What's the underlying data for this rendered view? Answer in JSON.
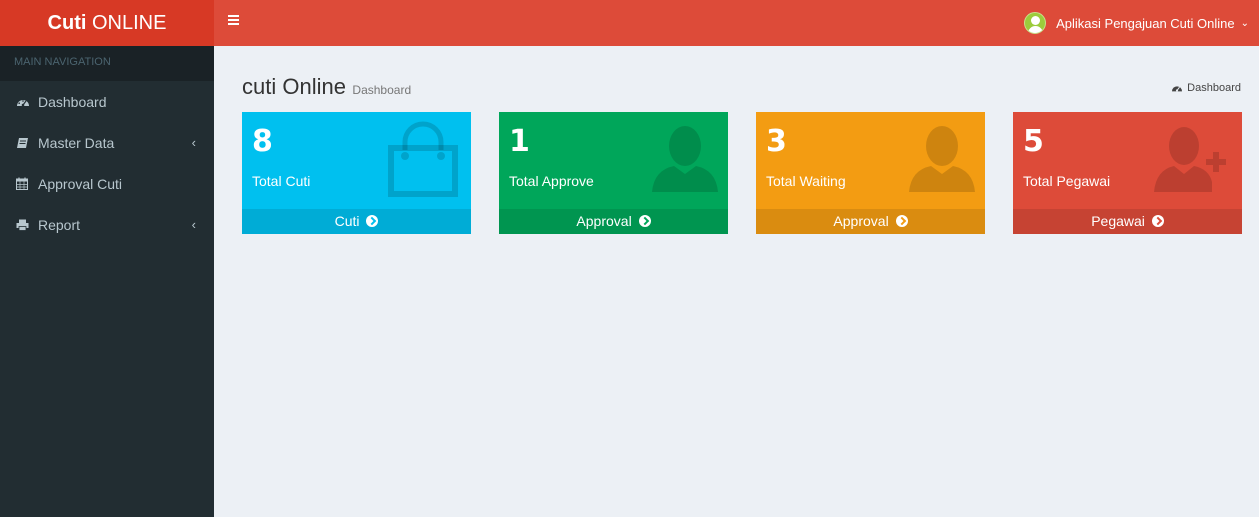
{
  "brand": {
    "bold": "Cuti",
    "rest": " ONLINE"
  },
  "navbar": {
    "user_label": "Aplikasi Pengajuan Cuti Online",
    "caret": "⌄"
  },
  "sidebar": {
    "header": "MAIN NAVIGATION",
    "items": [
      {
        "label": "Dashboard",
        "icon": "dashboard-icon",
        "chevron": ""
      },
      {
        "label": "Master Data",
        "icon": "book-icon",
        "chevron": "‹"
      },
      {
        "label": "Approval Cuti",
        "icon": "calendar-icon",
        "chevron": ""
      },
      {
        "label": "Report",
        "icon": "print-icon",
        "chevron": "‹"
      }
    ]
  },
  "content": {
    "title": "cuti Online",
    "subtitle": "Dashboard",
    "breadcrumb": "Dashboard"
  },
  "boxes": [
    {
      "number": "8",
      "label": "Total Cuti",
      "footer": "Cuti",
      "color": "#00c0ef",
      "icon": "shopping-bag-icon"
    },
    {
      "number": "1",
      "label": "Total Approve",
      "footer": "Approval",
      "color": "#00a65a",
      "icon": "user-icon"
    },
    {
      "number": "3",
      "label": "Total Waiting",
      "footer": "Approval",
      "color": "#f39c12",
      "icon": "user-icon"
    },
    {
      "number": "5",
      "label": "Total Pegawai",
      "footer": "Pegawai",
      "color": "#dd4b39",
      "icon": "user-plus-icon"
    }
  ]
}
